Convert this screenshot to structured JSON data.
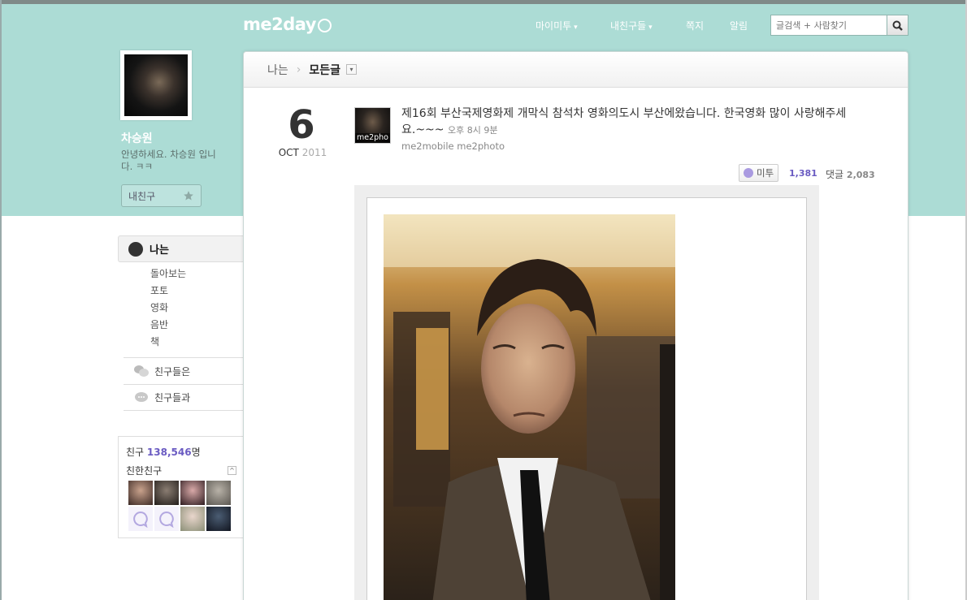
{
  "colors": {
    "brand": "#acdcd5",
    "accent": "#6a5bc2"
  },
  "app": {
    "logo": "me2day"
  },
  "nav": {
    "items": [
      {
        "label": "마이미투",
        "caret": "▾"
      },
      {
        "label": "내친구들",
        "caret": "▾"
      },
      {
        "label": "쪽지"
      },
      {
        "label": "알림"
      }
    ],
    "search_placeholder": "글검색 + 사람찾기",
    "search_icon": "search-icon"
  },
  "profile": {
    "name": "차승원",
    "bio": "안녕하세요. 차승원 입니다. ㅋㅋ",
    "friend_button": "내친구",
    "friend_button_icon": "star-icon"
  },
  "menu": {
    "main": "나는",
    "sub": [
      "돌아보는",
      "포토",
      "영화",
      "음반",
      "책"
    ],
    "rows": [
      {
        "label": "친구들은",
        "icon": "speech-bubbles-icon"
      },
      {
        "label": "친구들과",
        "icon": "chat-bubble-icon"
      }
    ]
  },
  "friends": {
    "label": "친구",
    "count": "138,546",
    "suffix": "명",
    "close_label": "친한친구",
    "collapse": "^"
  },
  "breadcrumb": {
    "first": "나는",
    "second": "모든글",
    "dropdown": "▾"
  },
  "post": {
    "day": "6",
    "month": "OCT",
    "year": "2011",
    "avatar_caption": "me2pho",
    "text": "제16회 부산국제영화제 개막식 참석차 영화의도시 부산에왔습니다. 한국영화 많이 사랑해주세요.~~~",
    "time": "오후 8시 9분",
    "meta": "me2mobile me2photo",
    "metoo_label": "미투",
    "metoo_count": "1,381",
    "comment_label": "댓글",
    "comment_count": "2,083"
  }
}
